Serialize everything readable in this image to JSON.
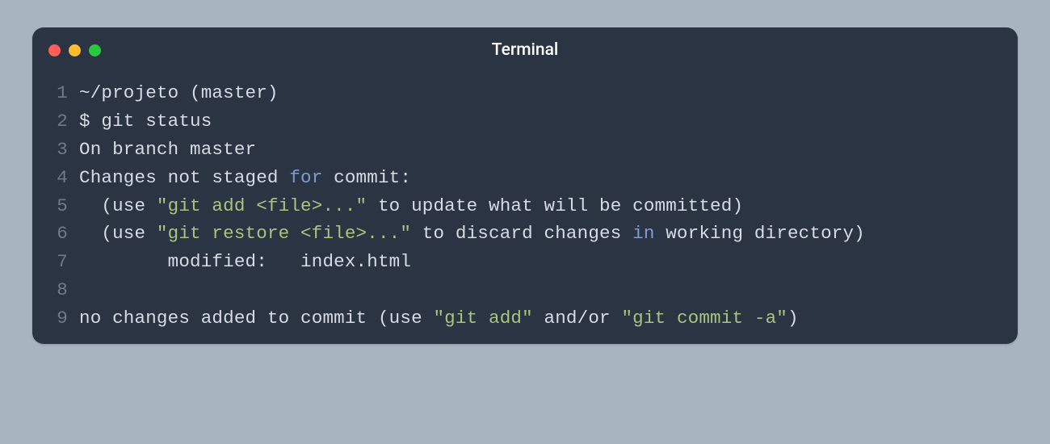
{
  "window": {
    "title": "Terminal",
    "traffic_lights": {
      "close": "#fe5f57",
      "minimize": "#febc2e",
      "zoom": "#28c840"
    }
  },
  "code": {
    "lines": [
      {
        "n": "1",
        "segments": [
          {
            "t": "~/projeto (master)",
            "c": "plain"
          }
        ]
      },
      {
        "n": "2",
        "segments": [
          {
            "t": "$ git status",
            "c": "plain"
          }
        ]
      },
      {
        "n": "3",
        "segments": [
          {
            "t": "On branch master",
            "c": "plain"
          }
        ]
      },
      {
        "n": "4",
        "segments": [
          {
            "t": "Changes not staged ",
            "c": "plain"
          },
          {
            "t": "for",
            "c": "kw"
          },
          {
            "t": " commit:",
            "c": "plain"
          }
        ]
      },
      {
        "n": "5",
        "segments": [
          {
            "t": "  (use ",
            "c": "plain"
          },
          {
            "t": "\"git add <file>...\"",
            "c": "str"
          },
          {
            "t": " to update what will be committed)",
            "c": "plain"
          }
        ]
      },
      {
        "n": "6",
        "segments": [
          {
            "t": "  (use ",
            "c": "plain"
          },
          {
            "t": "\"git restore <file>...\"",
            "c": "str"
          },
          {
            "t": " to discard changes ",
            "c": "plain"
          },
          {
            "t": "in",
            "c": "kw"
          },
          {
            "t": " working directory)",
            "c": "plain"
          }
        ]
      },
      {
        "n": "7",
        "segments": [
          {
            "t": "        modified:   index.html",
            "c": "plain"
          }
        ]
      },
      {
        "n": "8",
        "segments": [
          {
            "t": "",
            "c": "plain"
          }
        ]
      },
      {
        "n": "9",
        "segments": [
          {
            "t": "no changes added to commit (use ",
            "c": "plain"
          },
          {
            "t": "\"git add\"",
            "c": "str"
          },
          {
            "t": " and/or ",
            "c": "plain"
          },
          {
            "t": "\"git commit -a\"",
            "c": "str"
          },
          {
            "t": ")",
            "c": "plain"
          }
        ]
      }
    ]
  }
}
